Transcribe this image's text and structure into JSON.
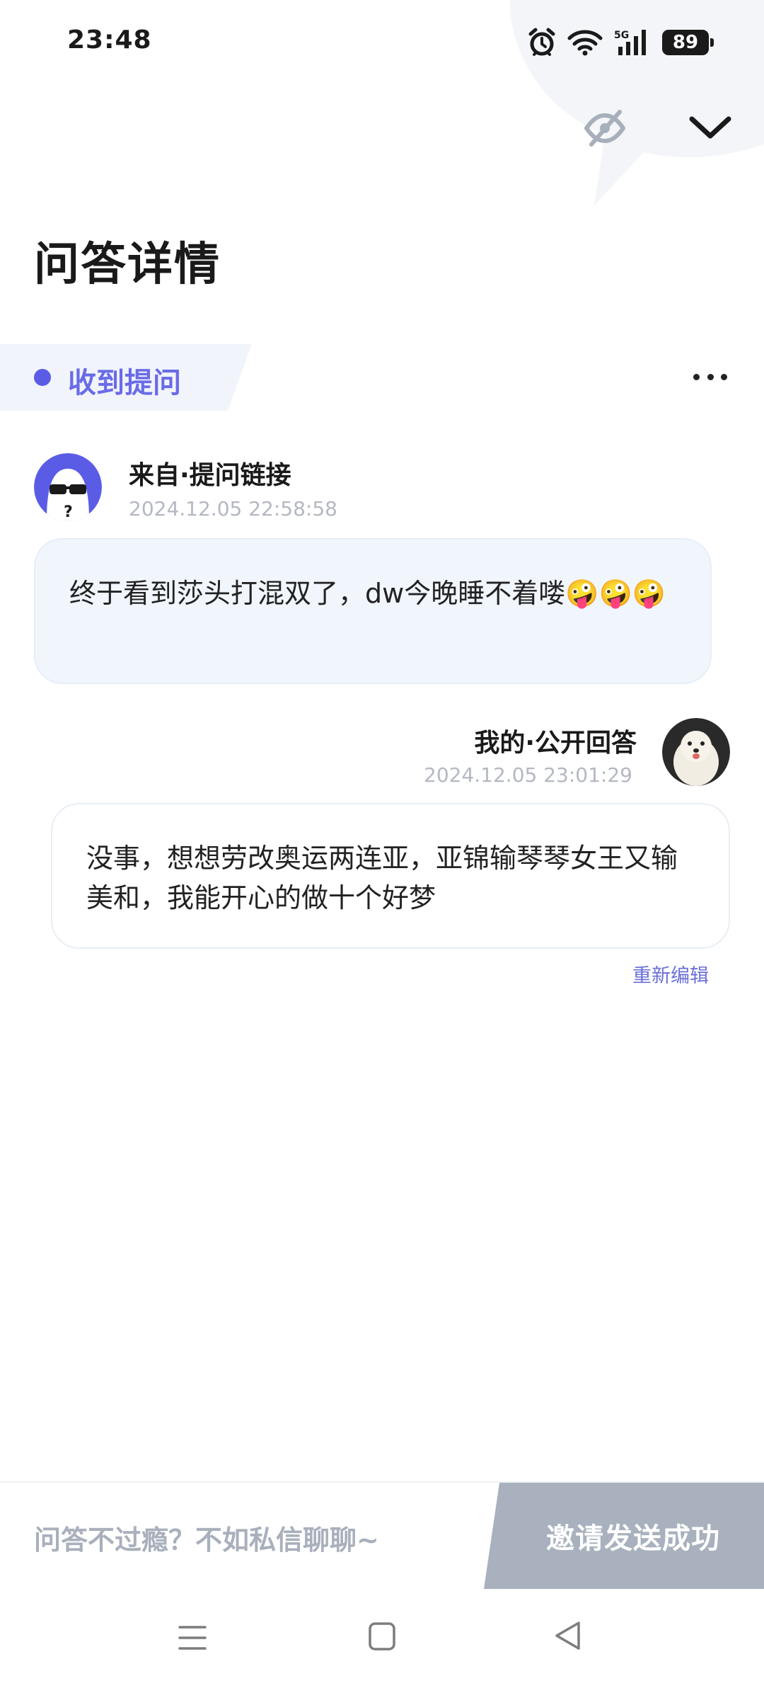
{
  "status_bar": {
    "time": "23:48",
    "network": "5G",
    "battery": "89",
    "icons": [
      "alarm-icon",
      "wifi-icon",
      "signal-5g-icon",
      "battery-icon"
    ]
  },
  "header": {
    "title": "问答详情",
    "icons": [
      "eye-off-icon",
      "chevron-down-icon"
    ]
  },
  "tag": {
    "label": "收到提问",
    "accent": "#5b5ce6"
  },
  "question": {
    "from": "来自·提问链接",
    "time": "2024.12.05 22:58:58",
    "text": "终于看到莎头打混双了，dw今晚睡不着喽🤪🤪🤪"
  },
  "answer": {
    "from": "我的·公开回答",
    "time": "2024.12.05 23:01:29",
    "text": "没事，想想劳改奥运两连亚，亚锦输琴琴女王又输美和，我能开心的做十个好梦",
    "edit_label": "重新编辑"
  },
  "bottom_bar": {
    "prompt": "问答不过瘾？不如私信聊聊~",
    "button_label": "邀请发送成功",
    "button_color": "#a8b1bd"
  },
  "nav_bar": {
    "icons": [
      "menu-icon",
      "home-icon",
      "back-icon"
    ]
  }
}
